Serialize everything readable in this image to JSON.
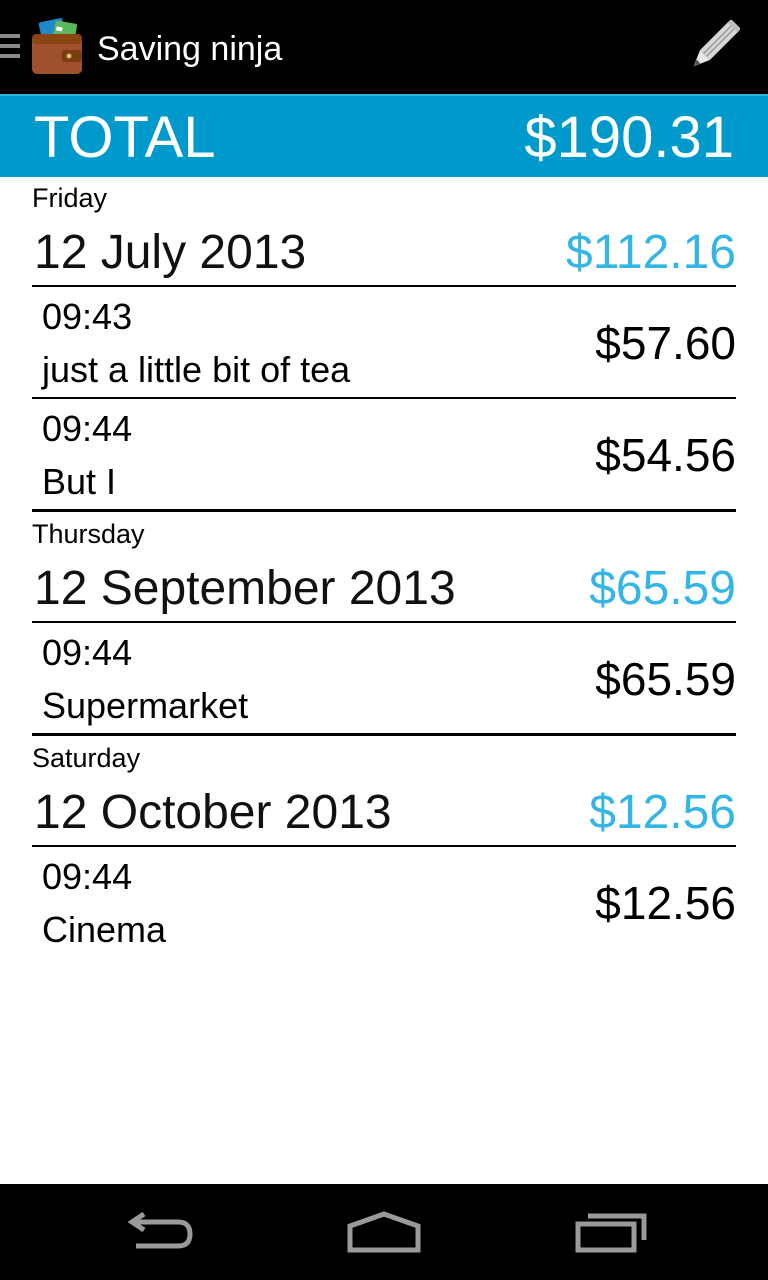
{
  "app": {
    "title": "Saving ninja"
  },
  "icons": {
    "drawer": "menu-icon",
    "logo": "wallet-icon",
    "edit": "pencil-icon",
    "back": "back-icon",
    "home": "home-icon",
    "recents": "recents-icon"
  },
  "colors": {
    "accent": "#33b5e5",
    "total_bar": "#0099cc",
    "action_bar": "#000000"
  },
  "total": {
    "label": "TOTAL",
    "value": "$190.31"
  },
  "days": [
    {
      "weekday": "Friday",
      "date": "12 July 2013",
      "total": "$112.16",
      "entries": [
        {
          "time": "09:43",
          "description": "just a little bit of tea",
          "amount": "$57.60"
        },
        {
          "time": "09:44",
          "description": "But I",
          "amount": "$54.56"
        }
      ]
    },
    {
      "weekday": "Thursday",
      "date": "12 September 2013",
      "total": "$65.59",
      "entries": [
        {
          "time": "09:44",
          "description": "Supermarket",
          "amount": "$65.59"
        }
      ]
    },
    {
      "weekday": "Saturday",
      "date": "12 October 2013",
      "total": "$12.56",
      "entries": [
        {
          "time": "09:44",
          "description": "Cinema",
          "amount": "$12.56"
        }
      ]
    }
  ]
}
